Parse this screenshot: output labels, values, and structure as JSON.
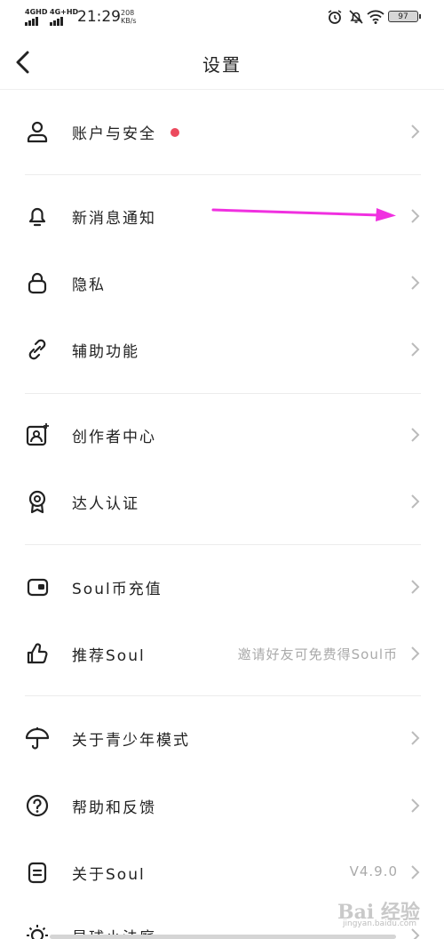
{
  "status_bar": {
    "network1": "4GHD",
    "network2": "4G+HD",
    "time": "21:29",
    "speed_value": "208",
    "speed_unit": "KB/s",
    "battery": "97"
  },
  "header": {
    "title": "设置"
  },
  "items": [
    {
      "label": "账户与安全",
      "value": "",
      "icon": "user-icon"
    },
    {
      "label": "新消息通知",
      "value": "",
      "icon": "bell-icon"
    },
    {
      "label": "隐私",
      "value": "",
      "icon": "lock-icon"
    },
    {
      "label": "辅助功能",
      "value": "",
      "icon": "link-icon"
    },
    {
      "label": "创作者中心",
      "value": "",
      "icon": "creator-icon"
    },
    {
      "label": "达人认证",
      "value": "",
      "icon": "badge-icon"
    },
    {
      "label": "Soul币充值",
      "value": "",
      "icon": "wallet-icon"
    },
    {
      "label": "推荐Soul",
      "value": "邀请好友可免费得Soul币",
      "icon": "thumbs-up-icon"
    },
    {
      "label": "关于青少年模式",
      "value": "",
      "icon": "umbrella-icon"
    },
    {
      "label": "帮助和反馈",
      "value": "",
      "icon": "help-icon"
    },
    {
      "label": "关于Soul",
      "value": "V4.9.0",
      "icon": "info-doc-icon"
    },
    {
      "label": "星球小法庭",
      "value": "",
      "icon": "sun-icon"
    }
  ],
  "colors": {
    "notification_dot": "#ec4a5e",
    "annotation_arrow": "#f030e0"
  },
  "watermark": {
    "text": "Bai 经验",
    "sub": "jingyan.baidu.com"
  }
}
